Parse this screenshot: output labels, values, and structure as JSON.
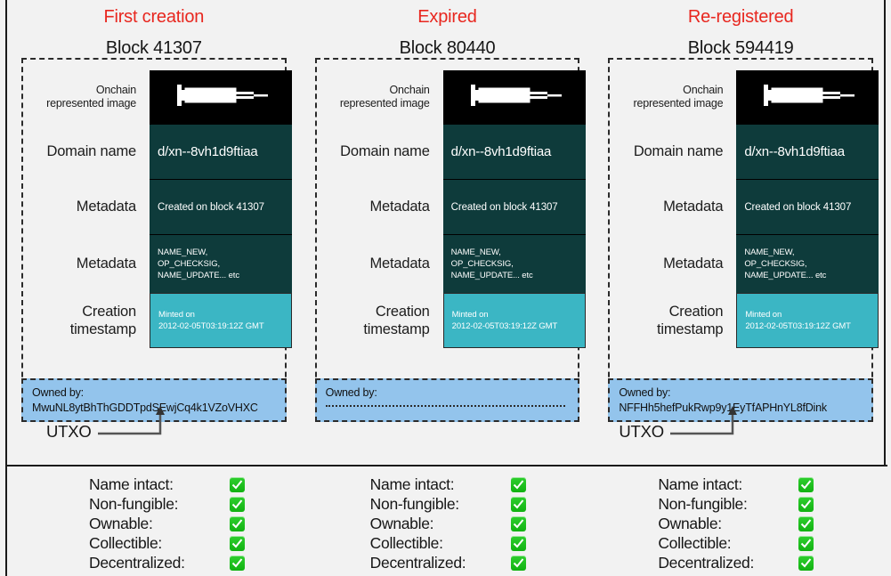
{
  "columns": [
    {
      "status": "First creation",
      "block": "Block 41307",
      "labels": {
        "image": "Onchain\nrepresented image",
        "image_line1": "Onchain",
        "image_line2": "represented image",
        "domain": "Domain name",
        "metadata1": "Metadata",
        "metadata2": "Metadata",
        "timestamp_line1": "Creation",
        "timestamp_line2": "timestamp"
      },
      "values": {
        "image_icon": "syringe-icon",
        "domain": "d/xn--8vh1d9ftiaa",
        "metadata1": "Created on block 41307",
        "metadata2_line1": "NAME_NEW,",
        "metadata2_line2": "OP_CHECKSIG,",
        "metadata2_line3": "NAME_UPDATE... etc",
        "timestamp_line1": "Minted on",
        "timestamp_line2": "2012-02-05T03:19:12Z GMT"
      },
      "owner_label": "Owned by:",
      "owner_value": "MwuNL8ytBhThGDDTpdSEwjCq4k1VZoVHXC",
      "owner_is_blank": false,
      "utxo_label": "UTXO",
      "show_utxo": true
    },
    {
      "status": "Expired",
      "block": "Block 80440",
      "labels": {
        "image": "Onchain\nrepresented image",
        "image_line1": "Onchain",
        "image_line2": "represented image",
        "domain": "Domain name",
        "metadata1": "Metadata",
        "metadata2": "Metadata",
        "timestamp_line1": "Creation",
        "timestamp_line2": "timestamp"
      },
      "values": {
        "image_icon": "syringe-icon",
        "domain": "d/xn--8vh1d9ftiaa",
        "metadata1": "Created on block 41307",
        "metadata2_line1": "NAME_NEW,",
        "metadata2_line2": "OP_CHECKSIG,",
        "metadata2_line3": "NAME_UPDATE... etc",
        "timestamp_line1": "Minted on",
        "timestamp_line2": "2012-02-05T03:19:12Z GMT"
      },
      "owner_label": "Owned by:",
      "owner_value": "",
      "owner_is_blank": true,
      "utxo_label": "",
      "show_utxo": false
    },
    {
      "status": "Re-registered",
      "block": "Block 594419",
      "labels": {
        "image": "Onchain\nrepresented image",
        "image_line1": "Onchain",
        "image_line2": "represented image",
        "domain": "Domain name",
        "metadata1": "Metadata",
        "metadata2": "Metadata",
        "timestamp_line1": "Creation",
        "timestamp_line2": "timestamp"
      },
      "values": {
        "image_icon": "syringe-icon",
        "domain": "d/xn--8vh1d9ftiaa",
        "metadata1": "Created on block 41307",
        "metadata2_line1": "NAME_NEW,",
        "metadata2_line2": "OP_CHECKSIG,",
        "metadata2_line3": "NAME_UPDATE... etc",
        "timestamp_line1": "Minted on",
        "timestamp_line2": "2012-02-05T03:19:12Z GMT"
      },
      "owner_label": "Owned by:",
      "owner_value": "NFFHh5hefPukRwp9y1EyTfAPHnYL8fDink",
      "owner_is_blank": false,
      "utxo_label": "UTXO",
      "show_utxo": true
    }
  ],
  "checklist": [
    {
      "items": [
        {
          "label": "Name intact:",
          "checked": true
        },
        {
          "label": "Non-fungible:",
          "checked": true
        },
        {
          "label": "Ownable:",
          "checked": true
        },
        {
          "label": "Collectible:",
          "checked": true
        },
        {
          "label": "Decentralized:",
          "checked": true
        }
      ]
    },
    {
      "items": [
        {
          "label": "Name intact:",
          "checked": true
        },
        {
          "label": "Non-fungible:",
          "checked": true
        },
        {
          "label": "Ownable:",
          "checked": true
        },
        {
          "label": "Collectible:",
          "checked": true
        },
        {
          "label": "Decentralized:",
          "checked": true
        }
      ]
    },
    {
      "items": [
        {
          "label": "Name intact:",
          "checked": true
        },
        {
          "label": "Non-fungible:",
          "checked": true
        },
        {
          "label": "Ownable:",
          "checked": true
        },
        {
          "label": "Collectible:",
          "checked": true
        },
        {
          "label": "Decentralized:",
          "checked": true
        }
      ]
    }
  ],
  "colors": {
    "status_red": "#e8271f",
    "card_teal_dark": "#0e3b3b",
    "card_teal_light": "#3bb6c4",
    "owner_blue": "#93c4ec",
    "image_black": "#000000",
    "check_green": "#15b515",
    "background": "#f2f2f2"
  }
}
